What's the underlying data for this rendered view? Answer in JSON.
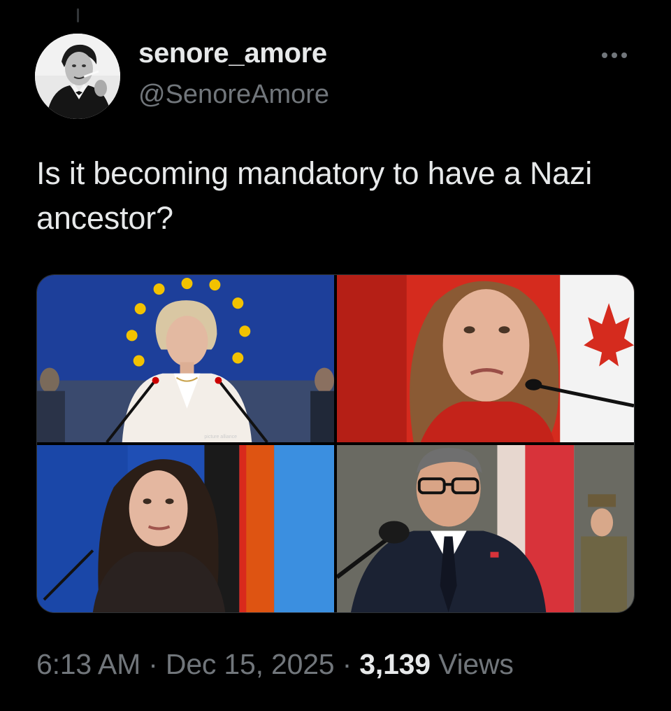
{
  "tweet": {
    "display_name": "senore_amore",
    "handle": "@SenoreAmore",
    "text": "Is it becoming mandatory to have a Nazi ancestor?",
    "time": "6:13 AM",
    "separator": "·",
    "date": "Dec 15, 2025",
    "views_count": "3,139",
    "views_label": "Views",
    "photo_credit": "picture alliance"
  },
  "icons": {
    "more": "more-horizontal-icon",
    "avatar": "profile-avatar"
  },
  "colors": {
    "background": "#000000",
    "primary_text": "#e7e9ea",
    "secondary_text": "#71767b",
    "border": "#2f3336",
    "eu_blue": "#1d3f9a",
    "eu_gold": "#f2c200",
    "canada_red": "#d52b1e"
  }
}
